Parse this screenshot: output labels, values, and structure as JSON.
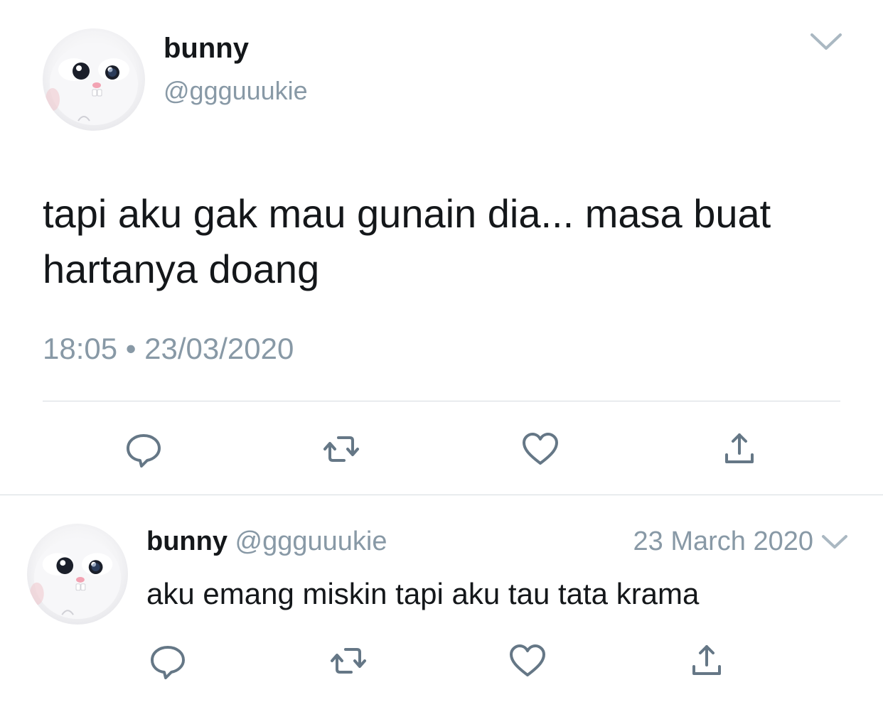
{
  "main_tweet": {
    "display_name": "bunny",
    "handle": "@ggguuukie",
    "text": "tapi aku gak mau gunain dia... masa buat hartanya doang",
    "timestamp": "18:05 • 23/03/2020",
    "menu_icon": "chevron-down-icon",
    "actions": [
      {
        "name": "reply",
        "icon": "reply-bubble-icon"
      },
      {
        "name": "retweet",
        "icon": "retweet-arrows-icon"
      },
      {
        "name": "like",
        "icon": "heart-icon"
      },
      {
        "name": "share",
        "icon": "share-upload-icon"
      }
    ]
  },
  "reply_tweet": {
    "display_name": "bunny",
    "handle": "@ggguuukie",
    "date": "23 March 2020",
    "text": "aku emang miskin tapi aku tau tata krama",
    "menu_icon": "chevron-down-icon",
    "actions": [
      {
        "name": "reply",
        "icon": "reply-bubble-icon"
      },
      {
        "name": "retweet",
        "icon": "retweet-arrows-icon"
      },
      {
        "name": "like",
        "icon": "heart-icon"
      },
      {
        "name": "share",
        "icon": "share-upload-icon"
      }
    ]
  },
  "colors": {
    "text_primary": "#14171a",
    "text_secondary": "#8899a6",
    "icon": "#657786",
    "divider": "#d6dbe0"
  }
}
